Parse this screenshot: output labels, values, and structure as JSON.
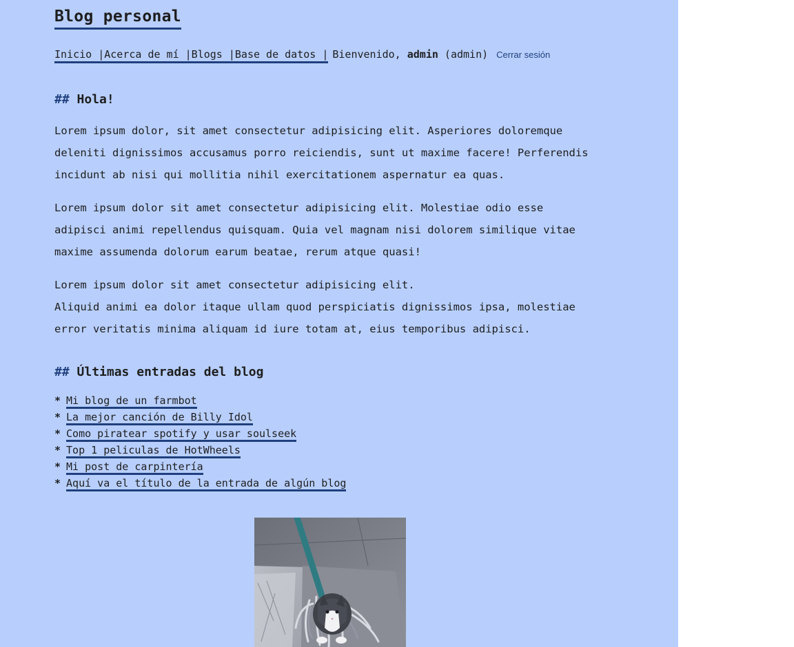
{
  "site": {
    "title": "Blog personal"
  },
  "nav": {
    "links": [
      "Inicio ",
      "|Acerca de mí ",
      "|Blogs ",
      "|Base de datos | "
    ],
    "welcome_prefix": "Bienvenido, ",
    "username": "admin",
    "role": " (admin)",
    "logout_label": "Cerrar sesión"
  },
  "intro": {
    "hash": "##",
    "heading": "Hola!",
    "paragraphs": [
      [
        "Lorem ipsum dolor, sit amet consectetur adipisicing elit. Asperiores doloremque",
        "deleniti dignissimos accusamus porro reiciendis, sunt ut maxime facere! Perferendis",
        "incidunt ab nisi qui mollitia nihil exercitationem aspernatur ea quas."
      ],
      [
        "Lorem ipsum dolor sit amet consectetur adipisicing elit. Molestiae odio esse",
        "adipisci animi repellendus quisquam. Quia vel magnam nisi dolorem similique vitae",
        "maxime assumenda dolorum earum beatae, rerum atque quasi!"
      ],
      [
        "Lorem ipsum dolor sit amet consectetur adipisicing elit.",
        "Aliquid animi ea dolor itaque ullam quod perspiciatis dignissimos ipsa, molestiae",
        "error veritatis minima aliquam id iure totam at, eius temporibus adipisci."
      ]
    ]
  },
  "posts": {
    "hash": "##",
    "heading": "Últimas entradas del blog",
    "bullet": "*",
    "items": [
      "Mi blog de un farmbot",
      "La mejor canción de Billy Idol",
      "Como piratear spotify y usar soulseek",
      "Top 1 peliculas de HotWheels",
      "Mi post de carpintería",
      "Aquí va el título de la entrada de algún blog"
    ]
  },
  "image": {
    "icon": "cat-photo"
  },
  "colors": {
    "page_bg": "#b8cffd",
    "accent": "#1f3f7d",
    "text": "#1e1e1e"
  }
}
